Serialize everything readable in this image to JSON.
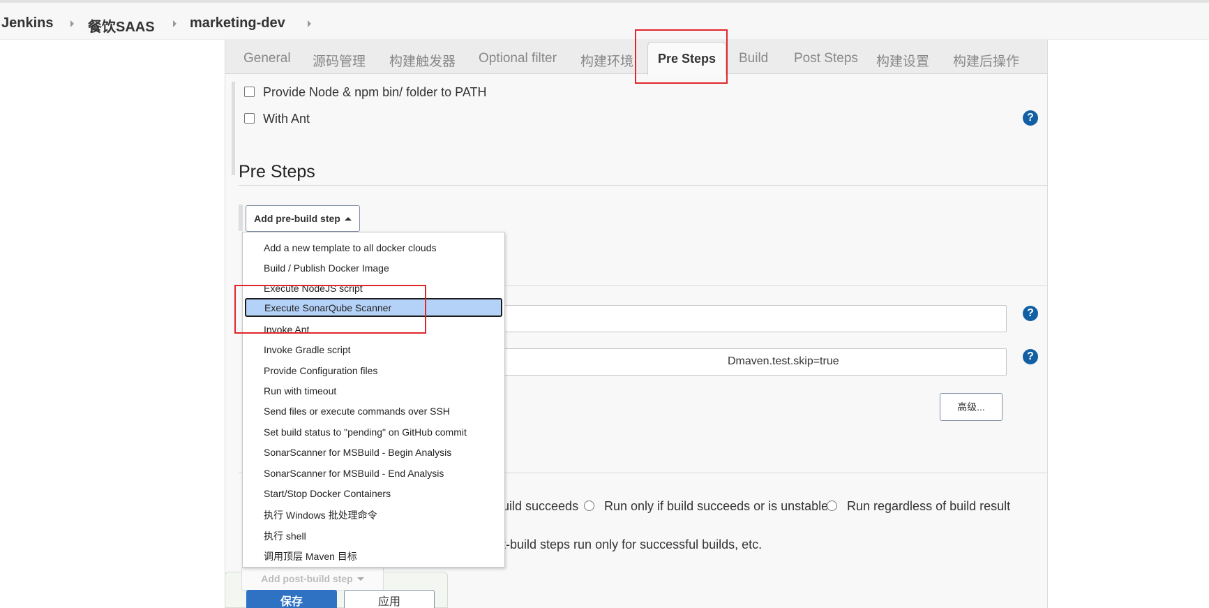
{
  "breadcrumb": {
    "items": [
      "Jenkins",
      "餐饮SAAS",
      "marketing-dev"
    ]
  },
  "tabs": [
    "General",
    "源码管理",
    "构建触发器",
    "Optional filter",
    "构建环境",
    "Pre Steps",
    "Build",
    "Post Steps",
    "构建设置",
    "构建后操作"
  ],
  "active_tab": "Pre Steps",
  "build_env": {
    "checkbox_node": "Provide Node & npm bin/ folder to PATH",
    "checkbox_ant": "With Ant"
  },
  "help_icon_text": "?",
  "pre_steps": {
    "title": "Pre Steps",
    "add_button": "Add pre-build step"
  },
  "build": {
    "goals_value": "Dmaven.test.skip=true",
    "advanced_button": "高级..."
  },
  "post_steps": {
    "radio_1_partial": "uild succeeds",
    "radio_2": "Run only if build succeeds or is unstable",
    "radio_3": "Run regardless of build result",
    "description_partial": "t-build steps run only for successful builds, etc.",
    "add_button": "Add post-build step"
  },
  "footer": {
    "save": "保存",
    "apply": "应用"
  },
  "menu": {
    "items": [
      "Add a new template to all docker clouds",
      "Build / Publish Docker Image",
      "Execute NodeJS script",
      "Execute SonarQube Scanner",
      "Invoke Ant",
      "Invoke Gradle script",
      "Provide Configuration files",
      "Run with timeout",
      "Send files or execute commands over SSH",
      "Set build status to \"pending\" on GitHub commit",
      "SonarScanner for MSBuild - Begin Analysis",
      "SonarScanner for MSBuild - End Analysis",
      "Start/Stop Docker Containers",
      "执行 Windows 批处理命令",
      "执行 shell",
      "调用顶层 Maven 目标"
    ],
    "selected": "Execute SonarQube Scanner"
  },
  "colors": {
    "annotation_red": "#e0262b",
    "selected_item_bg": "#b4d2f7",
    "save_blue": "#2f72c4",
    "help_blue": "#135fa3"
  }
}
